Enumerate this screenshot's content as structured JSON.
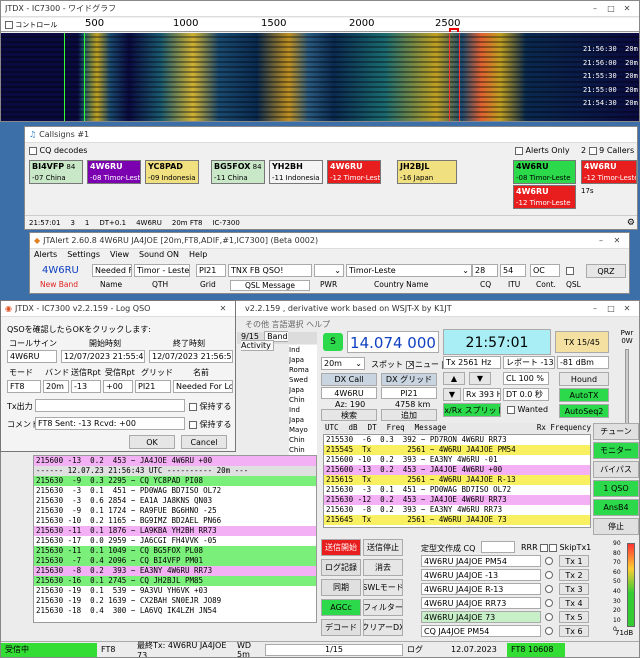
{
  "waterfall": {
    "title": "JTDX - IC7300 - ワイドグラフ",
    "control_label": "コントロール",
    "freq_ticks": [
      "500",
      "1000",
      "1500",
      "2000",
      "2500"
    ],
    "times": [
      "21:56:30",
      "21:56:00",
      "21:55:30",
      "21:55:00",
      "21:54:30"
    ],
    "band": "20m",
    "colors": {
      "bg": "#0a0a40",
      "signal": "#f0d020",
      "hot": "#e04030"
    }
  },
  "callsigns": {
    "title": "Callsigns #1",
    "cq_label": "CQ decodes",
    "alerts_label": "Alerts Only",
    "callers_label": "Callers : Alerts",
    "cards": [
      {
        "call": "BI4VFP",
        "sub": "-07 China",
        "extra": "84",
        "color": "#c8e8c8"
      },
      {
        "call": "4W6RU",
        "sub": "-08 Timor-Leste",
        "extra": "",
        "color": "#7a00b0"
      },
      {
        "call": "YC8PAD",
        "sub": "-09 Indonesia",
        "extra": "",
        "color": "#f0e080"
      },
      {
        "call": "BG5FOX",
        "sub": "-11 China",
        "extra": "84",
        "color": "#c8e8c8"
      },
      {
        "call": "YH2BH",
        "sub": "-11 Indonesia",
        "extra": "",
        "color": "#f4f4f4"
      },
      {
        "call": "4W6RU",
        "sub": "-12 Timor-Leste",
        "extra": "",
        "color": "#e81d1d"
      },
      {
        "call": "JH2BJL",
        "sub": "-16 Japan",
        "extra": "",
        "color": "#f0e080"
      }
    ],
    "alert_cards": [
      {
        "call": "4W6RU",
        "sub": "-08 Timor-Leste"
      },
      {
        "call": "4W6RU",
        "sub": "-12 Timor-Leste"
      }
    ],
    "caller_card": {
      "call": "4W6RU",
      "sub": "-12 Timor-Leste",
      "age": "17s"
    },
    "status": [
      "21:57:01",
      "3",
      "1",
      "DT+0.1",
      "4W6RU",
      "20m FT8",
      "IC-7300"
    ]
  },
  "jtalert": {
    "title": "JTAlert 2.60.8 4W6RU JA4JOE [20m,FT8,ADIF,#1,IC7300] (Beta 0002)",
    "menu": [
      "Alerts",
      "Settings",
      "View",
      "Sound ON",
      "Help"
    ],
    "call": "4W6RU",
    "name": "Needed F",
    "country": "Timor - Leste,",
    "grid": "PI21",
    "qsl_msg": "TNX FB QSO!",
    "country2": "Timor-Leste",
    "cq": "28",
    "itu": "54",
    "cont": "OC",
    "labels": [
      "New Band",
      "Name",
      "QTH",
      "Grid",
      "QSL Message",
      "PWR",
      "Country Name",
      "CQ",
      "ITU",
      "Cont.",
      "QSL"
    ],
    "qrz": "QRZ"
  },
  "logqso": {
    "title": "JTDX - IC7300 v2.2.159 - Log QSO",
    "instr": "QSOを確認したらOKをクリックします:",
    "lbl_call": "コールサイン",
    "lbl_start": "開始時刻",
    "lbl_end": "終了時刻",
    "call": "4W6RU",
    "start": "12/07/2023 21:55:45",
    "end": "12/07/2023 21:56:59",
    "lbl_mode": "モード",
    "lbl_band": "バンド",
    "lbl_tx": "送信Rpt",
    "lbl_rx": "受信Rpt",
    "lbl_grid": "グリッド",
    "lbl_name": "名前",
    "mode": "FT8",
    "band": "20m",
    "rpt_tx": "-13",
    "rpt_rx": "+00",
    "grid": "PI21",
    "name": "Needed For Log",
    "lbl_txpwr": "Tx出力",
    "lbl_comment": "コメント",
    "keep": "保持する",
    "comment": "FT8  Sent: -13  Rcvd: +00",
    "ok": "OK",
    "cancel": "Cancel"
  },
  "main": {
    "title": "v2.2.159 , derivative work based on WSJT-X by K1JT",
    "menu_frag": "その他  言語選択  ヘルプ",
    "band_activity": "Band Activity",
    "left_rows": [
      {
        "t": "215600 -13  0.2  453 ~ JA4JOE 4W6RU +00",
        "bg": "#f4b0f4"
      },
      {
        "t": "------ 12.07.23 21:56:43 UTC ---------- 20m ---",
        "bg": "#e0e0e0"
      },
      {
        "t": "215630  -9  0.3 2295 ~ CQ YC8PAD PI08",
        "bg": "#7af07a"
      },
      {
        "t": "215630  -3  0.1  451 ~ PD0WAG BD7ISO OL72",
        "bg": "#ffffff"
      },
      {
        "t": "215630  -3  0.6 2854 ~ EA1A JA8KNS QN03",
        "bg": "#ffffff"
      },
      {
        "t": "215630  -9  0.1 1724 ~ RA9FUE BG6HNO -25",
        "bg": "#ffffff"
      },
      {
        "t": "215630 -10  0.2 1165 ~ BG9IMZ BD2AEL PN66",
        "bg": "#ffffff"
      },
      {
        "t": "215630 -11  0.1 1876 ~ LA9KBA YH2BH RR73",
        "bg": "#f4b0f4"
      },
      {
        "t": "215630 -17  0.0 2959 ~ JA6CGI FH4VVK -05",
        "bg": "#ffffff"
      },
      {
        "t": "215630 -11  0.1 1049 ~ CQ BG5FOX PL08",
        "bg": "#7af07a"
      },
      {
        "t": "215630  -7  0.4 2096 ~ CQ BI4VFP PM01",
        "bg": "#7af07a"
      },
      {
        "t": "215630  -8  0.2  393 ~ EA3NY 4W6RU RR73",
        "bg": "#f4b0f4"
      },
      {
        "t": "215630 -16  0.1 2745 ~ CQ JH2BJL PM85",
        "bg": "#7af07a"
      },
      {
        "t": "215630 -19  0.1  539 ~ 9A3VU YH6VK +03",
        "bg": "#ffffff"
      },
      {
        "t": "215630 -19  0.2 1639 ~ CX2BAH SN0EJR JO89",
        "bg": "#ffffff"
      },
      {
        "t": "215630 -18  0.4  300 ~ LA6VQ IK4LZH JN54",
        "bg": "#ffffff"
      }
    ],
    "right_countries": [
      "Ind",
      "Japa",
      "Roma",
      "Swed",
      "Japa",
      "Chin",
      "Ind",
      "Japa",
      "Mayo",
      "Chin",
      "Chin"
    ],
    "freq": "14.074 000",
    "time": "21:57:01",
    "tx_badge": "TX 15/45",
    "pwr": "Pwr",
    "pwr_db": "0W",
    "band_sel": "20m",
    "scope": "スポット",
    "menu_chk": "メニュー",
    "tx_hz": "Tx  2561 Hz",
    "report": "レポート -13",
    "dbm": "-81 dBm",
    "dx_call_btn": "DX Call",
    "dx_grid_btn": "DX グリッド",
    "dx_call": "4W6RU",
    "dx_grid": "PI21",
    "az": "Az: 190",
    "dist": "4758 km",
    "search": "検索",
    "add": "追加",
    "rx_hz": "Rx  393 Hz",
    "cl": "CL  100 %",
    "dt": "DT 0.0 秒",
    "hound": "Hound",
    "autotx": "AutoTX",
    "autoseq": "AutoSeq2",
    "txrx": "Tx/Rx スプリット",
    "wanted": "Wanted",
    "hdr": [
      "UTC",
      "dB",
      "DT",
      "Freq",
      "Message",
      "Rx Frequency"
    ],
    "right_rows": [
      {
        "t": "215530  -6  0.3  392 ~ PD7RON 4W6RU RR73",
        "bg": "#ffffff"
      },
      {
        "t": "215545  Tx        2561 ~ 4W6RU JA4JOE PM54",
        "bg": "#f8f060"
      },
      {
        "t": "215600 -10  0.2  393 ~ EA3NY 4W6RU -01",
        "bg": "#ffffff"
      },
      {
        "t": "215600 -13  0.2  453 ~ JA4JOE 4W6RU +00",
        "bg": "#f4b0f4"
      },
      {
        "t": "215615  Tx        2561 ~ 4W6RU JA4JOE R-13",
        "bg": "#f8f060"
      },
      {
        "t": "215630  -3  0.1  451 ~ PD0WAG BD7ISO OL72",
        "bg": "#ffffff"
      },
      {
        "t": "215630 -12  0.2  453 ~ JA4JOE 4W6RU RR73",
        "bg": "#f4b0f4"
      },
      {
        "t": "215630  -8  0.2  393 ~ EA3NY 4W6RU RR73",
        "bg": "#ffffff"
      },
      {
        "t": "215645  Tx        2561 ~ 4W6RU JA4JOE 73",
        "bg": "#f8f060"
      }
    ],
    "side_btns": [
      "チューン",
      "モニター",
      "バイパス",
      "1 QSO",
      "AnsB4",
      "停止"
    ],
    "bottom_btns": [
      "送信開始",
      "ログ記録",
      "同期",
      "AGCc",
      "デコード"
    ],
    "bottom_btns2": [
      "送信停止",
      "消去",
      "SWLモード",
      "フィルター",
      "クリアーDX"
    ],
    "gen_label": "定型文作成 CQ",
    "rrr": "RRR",
    "skiptx": "SkipTx1",
    "msgs": [
      "4W6RU JA4JOE PM54",
      "4W6RU JA4JOE -13",
      "4W6RU JA4JOE R-13",
      "4W6RU JA4JOE RR73",
      "4W6RU JA4JOE 73",
      "CQ JA4JOE PM54"
    ],
    "tx_labels": [
      "Tx 1",
      "Tx 2",
      "Tx 3",
      "Tx 4",
      "Tx 5",
      "Tx 6"
    ],
    "meter_ticks": [
      "90",
      "80",
      "70",
      "60",
      "50",
      "40",
      "30",
      "20",
      "10",
      "0"
    ],
    "meter_db": "71dB",
    "status": [
      "受信中",
      "FT8",
      "最終Tx: 4W6RU JA4JOE 73",
      "WD 5m",
      "1/15",
      "ログ",
      "12.07.2023",
      "FT8  10608"
    ]
  }
}
